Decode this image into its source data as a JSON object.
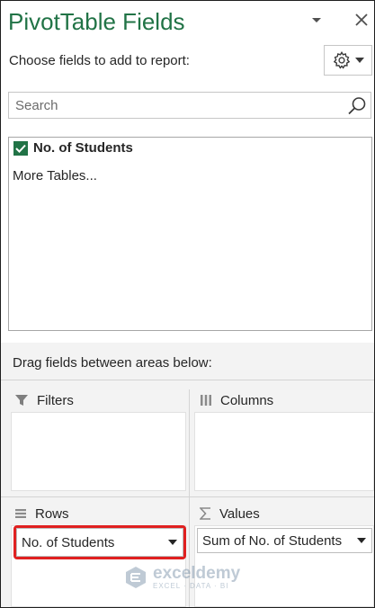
{
  "pane": {
    "title": "PivotTable Fields",
    "choose_label": "Choose fields to add to report:",
    "icons": {
      "options": "chevron-down-icon",
      "close": "close-icon",
      "tools": "gear-icon",
      "search": "search-icon"
    }
  },
  "search": {
    "placeholder": "Search",
    "value": ""
  },
  "fields": [
    {
      "label": "No. of Students",
      "checked": true
    }
  ],
  "more_tables": "More Tables...",
  "areas": {
    "instruction": "Drag fields between areas below:",
    "filters": {
      "label": "Filters",
      "icon": "filter-icon"
    },
    "columns": {
      "label": "Columns",
      "icon": "columns-icon"
    },
    "rows": {
      "label": "Rows",
      "icon": "rows-icon",
      "item": "No. of Students"
    },
    "values": {
      "label": "Values",
      "icon": "sigma-icon",
      "item": "Sum of No. of Students"
    }
  },
  "watermark": {
    "name": "exceldemy",
    "tagline": "EXCEL · DATA · BI"
  },
  "colors": {
    "accent": "#217346",
    "highlight": "#e02020"
  }
}
